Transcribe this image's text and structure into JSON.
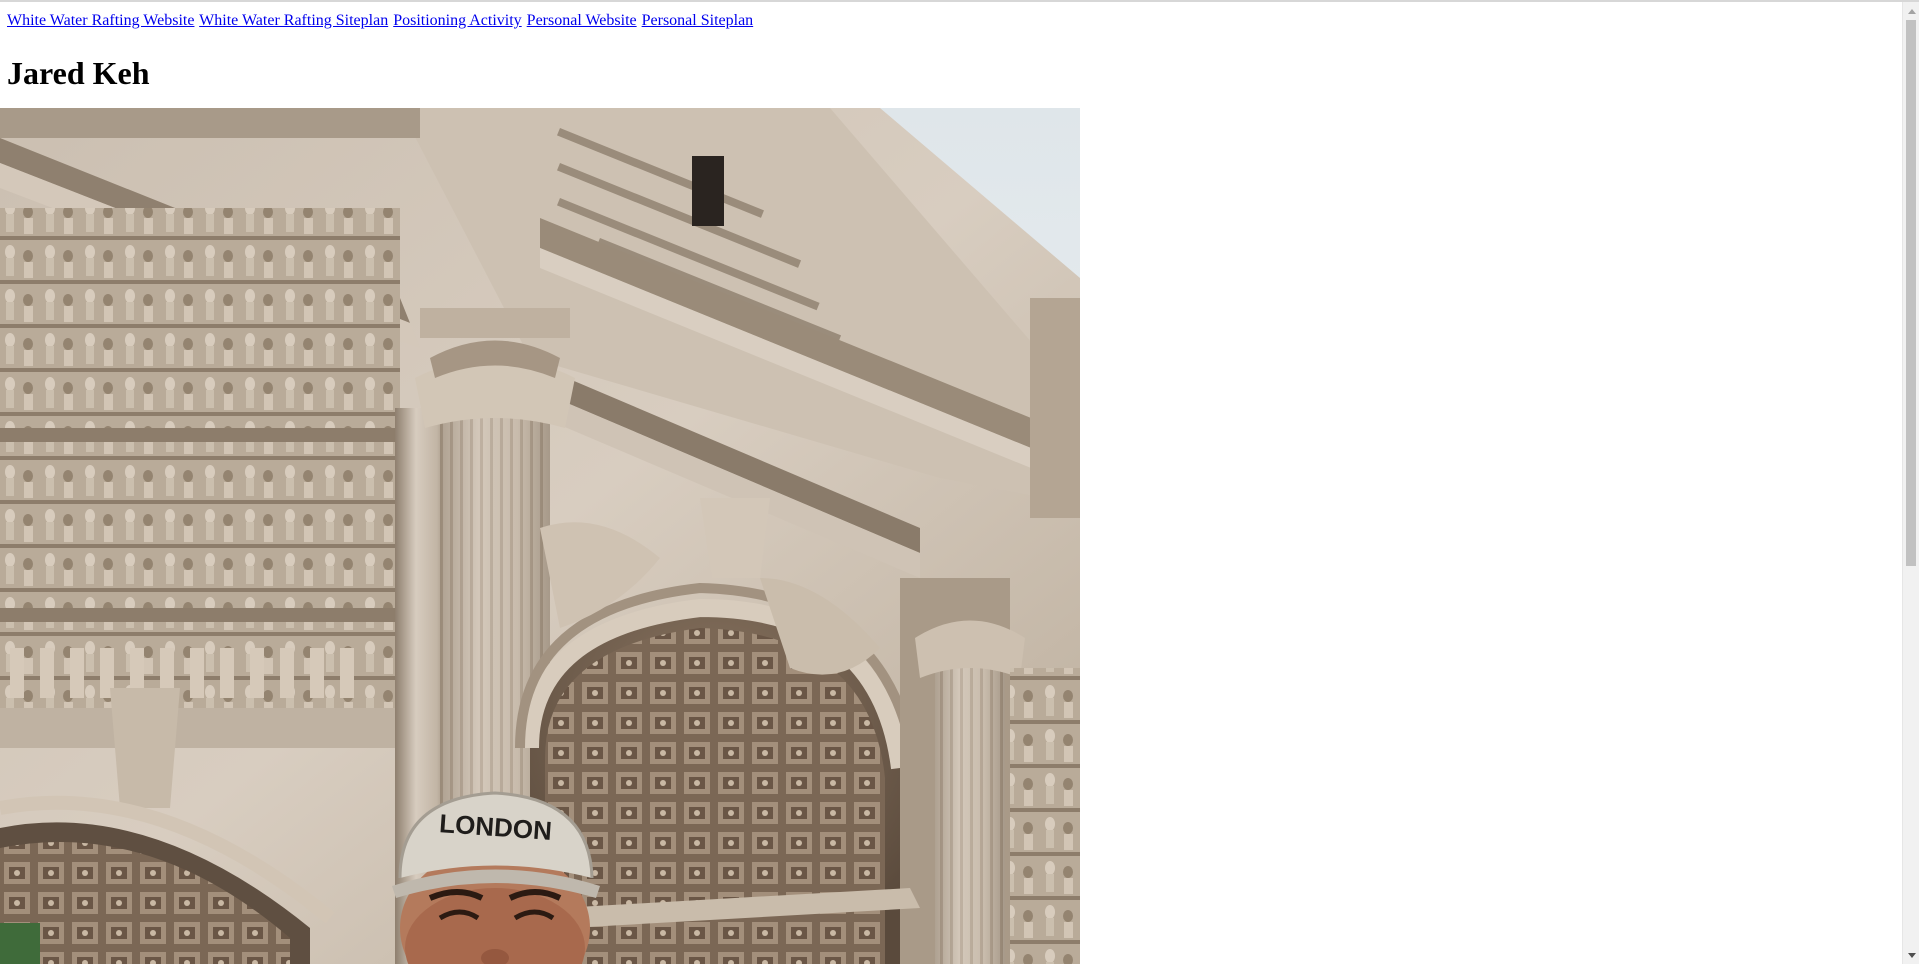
{
  "nav": {
    "links": [
      "White Water Rafting Website",
      "White Water Rafting Siteplan",
      "Positioning Activity",
      "Personal Website",
      "Personal Siteplan"
    ]
  },
  "page": {
    "heading": "Jared Keh"
  },
  "photo": {
    "subject": "arch-with-person-photo",
    "colors": {
      "sky": "#e9edf0",
      "stone_light": "#d9cfc3",
      "stone_mid": "#b3a594",
      "stone_dark": "#7d6e5e",
      "shadow": "#5a4c3f",
      "cap": "#d8d3c9",
      "skin": "#b47a5c",
      "foliage": "#3f6b3a"
    },
    "cap_lettering": "LONDON"
  },
  "scrollbar": {
    "thumb_fraction": 0.59
  }
}
